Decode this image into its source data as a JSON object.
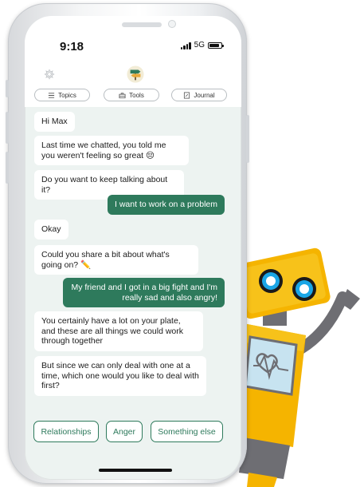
{
  "status_bar": {
    "time": "9:18",
    "network": "5G"
  },
  "icons": {
    "settings": "gear-icon",
    "logo": "signpost-logo-icon",
    "topics": "list-icon",
    "tools": "toolbox-icon",
    "journal": "journal-icon"
  },
  "tabs": [
    {
      "label": "Topics",
      "icon": "list-icon"
    },
    {
      "label": "Tools",
      "icon": "toolbox-icon"
    },
    {
      "label": "Journal",
      "icon": "journal-icon"
    }
  ],
  "messages": [
    {
      "from": "bot",
      "text": "Hi Max"
    },
    {
      "from": "bot",
      "text": "Last time we chatted, you told me you weren't feeling so great 😔"
    },
    {
      "from": "bot",
      "text": "Do you want to keep talking about it?"
    },
    {
      "from": "user",
      "text": "I want to work on a problem"
    },
    {
      "from": "bot",
      "text": "Okay"
    },
    {
      "from": "bot",
      "text": "Could you share a bit about what's going on? ✏️"
    },
    {
      "from": "user",
      "text": "My friend and I got in a big fight and I'm really sad and also angry!"
    },
    {
      "from": "bot",
      "text": "You certainly have a lot on your plate, and these are all things we could work through together"
    },
    {
      "from": "bot",
      "text": "But since we can only deal with one at a time, which one would you like to deal with first?"
    }
  ],
  "quick_replies": [
    "Relationships",
    "Anger",
    "Something else"
  ],
  "colors": {
    "accent": "#2e7a5c",
    "chat_background": "#edf3f1",
    "robot_yellow": "#f5b400",
    "robot_gray": "#6e6e73",
    "eye_blue": "#1aa6e6"
  }
}
